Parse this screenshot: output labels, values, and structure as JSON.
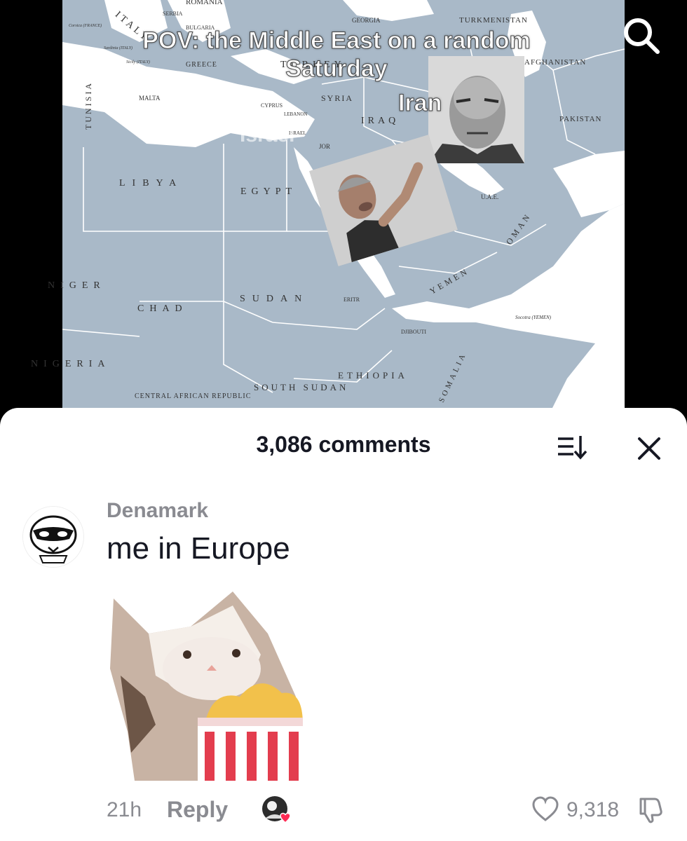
{
  "video": {
    "caption": "POV: the Middle East on a random Saturday",
    "iran_caption": "Iran",
    "israel_caption": "Israel",
    "map_labels": [
      "TURKMENISTAN",
      "AFGHANISTAN",
      "PAKISTAN",
      "GEORGIA",
      "ROMANIA",
      "BULGARIA",
      "SERBIA",
      "ITALY",
      "GREECE",
      "TURKEY",
      "SYRIA",
      "IRAQ",
      "CYPRUS",
      "LEBANON",
      "ISRAEL",
      "JOR",
      "MALTA",
      "TUNISIA",
      "LIBYA",
      "EGYPT",
      "SUDAN",
      "CHAD",
      "NIGER",
      "NIGERIA",
      "ERITR",
      "YEMEN",
      "OMAN",
      "U.A.E.",
      "DJIBOUTI",
      "Socotra (YEMEN)",
      "ETHIOPIA",
      "SOMALIA",
      "SOUTH SUDAN",
      "CENTRAL AFRICAN REPUBLIC",
      "Sardinia (ITALY)",
      "Sicily (ITALY)",
      "Corsica (FRANCE)"
    ],
    "icon": "search-icon"
  },
  "comments_sheet": {
    "title": "3,086 comments",
    "sort_icon": "sort-icon",
    "close_icon": "close-icon"
  },
  "comment": {
    "username": "Denamark",
    "text": "me in Europe",
    "time": "21h",
    "reply_label": "Reply",
    "like_count": "9,318",
    "creator_liked": true
  },
  "colors": {
    "map_water": "#ffffff",
    "map_land": "#a9b9c8",
    "text_primary": "#161823",
    "text_secondary": "#8a8b91",
    "creator_heart": "#fe2c55"
  }
}
